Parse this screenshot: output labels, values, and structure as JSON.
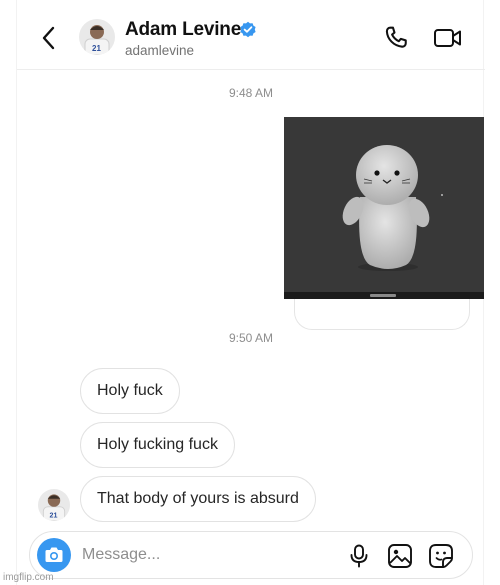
{
  "header": {
    "name": "Adam Levine",
    "handle": "adamlevine",
    "verified": true,
    "back_icon": "chevron-left-icon",
    "call_icon": "phone-icon",
    "video_icon": "video-camera-icon"
  },
  "thread": {
    "timestamps": [
      "9:48 AM",
      "9:50 AM"
    ],
    "shared_media": {
      "description_icon": "seal-plush-image",
      "background": "#383838"
    },
    "messages": [
      {
        "text": "Holy fuck"
      },
      {
        "text": "Holy fucking fuck"
      },
      {
        "text": "That body of yours is absurd"
      }
    ]
  },
  "composer": {
    "placeholder": "Message...",
    "camera_icon": "camera-icon",
    "mic_icon": "microphone-icon",
    "gallery_icon": "image-icon",
    "sticker_icon": "sticker-icon",
    "accent": "#3797f0"
  },
  "watermark": "imgflip.com",
  "colors": {
    "verified_badge": "#3897f0",
    "bubble_border": "#e2e2e2",
    "text": "#262626",
    "muted": "#8e8e8e"
  }
}
